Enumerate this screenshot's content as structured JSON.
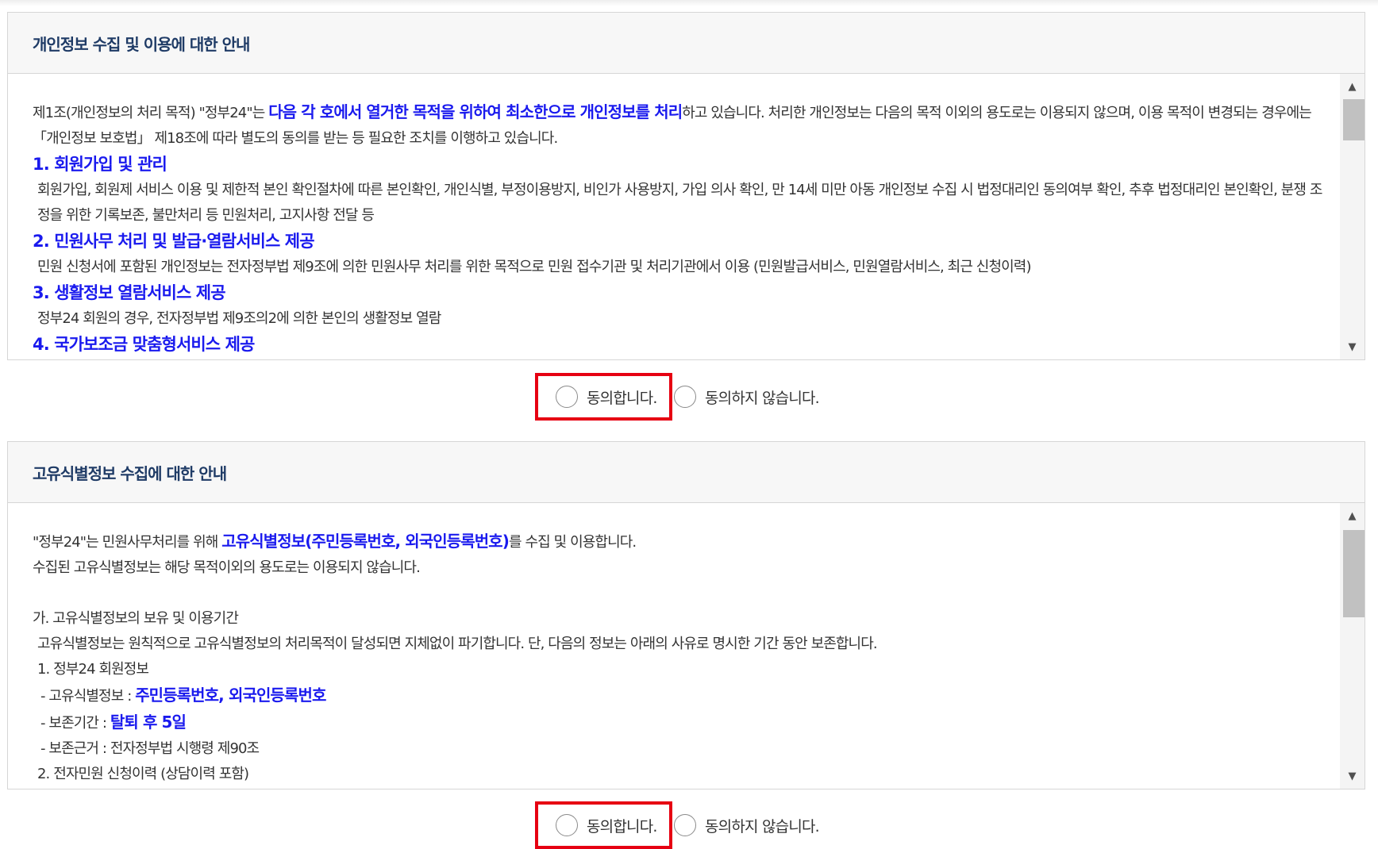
{
  "sections": [
    {
      "title": "개인정보 수집 및 이용에 대한 안내",
      "intro": {
        "pre": "제1조(개인정보의 처리 목적) \"정부24\"는 ",
        "highlight": "다음 각 호에서 열거한 목적을 위하여 최소한으로 개인정보를 처리",
        "post": "하고 있습니다. 처리한 개인정보는 다음의 목적 이외의 용도로는 이용되지 않으며, 이용 목적이 변경되는 경우에는 「개인정보 보호법」 제18조에 따라 별도의 동의를 받는 등 필요한 조치를 이행하고 있습니다."
      },
      "items": [
        {
          "heading": "1. 회원가입 및 관리",
          "text": "회원가입, 회원제 서비스 이용 및 제한적 본인 확인절차에 따른 본인확인, 개인식별, 부정이용방지, 비인가 사용방지, 가입 의사 확인, 만 14세 미만 아동 개인정보 수집 시 법정대리인 동의여부 확인, 추후 법정대리인 본인확인, 분쟁 조정을 위한 기록보존, 불만처리 등 민원처리, 고지사항 전달 등"
        },
        {
          "heading": "2. 민원사무 처리 및 발급·열람서비스 제공",
          "text": "민원 신청서에 포함된 개인정보는 전자정부법 제9조에 의한 민원사무 처리를 위한 목적으로 민원 접수기관 및 처리기관에서 이용 (민원발급서비스, 민원열람서비스, 최근 신청이력)"
        },
        {
          "heading": "3. 생활정보 열람서비스 제공",
          "text": "정부24 회원의 경우, 전자정부법 제9조의2에 의한 본인의 생활정보 열람"
        },
        {
          "heading": "4. 국가보조금 맞춤형서비스 제공",
          "text": ""
        }
      ],
      "agree_label": "동의합니다.",
      "disagree_label": "동의하지 않습니다."
    },
    {
      "title": "고유식별정보 수집에 대한 안내",
      "line1": {
        "pre": "\"정부24\"는 민원사무처리를 위해 ",
        "highlight": "고유식별정보(주민등록번호, 외국인등록번호)",
        "post": "를 수집 및 이용합니다."
      },
      "line2": "수집된 고유식별정보는 해당 목적이외의 용도로는 이용되지 않습니다.",
      "subheading": "가. 고유식별정보의 보유 및 이용기간",
      "subtext": "고유식별정보는 원칙적으로 고유식별정보의 처리목적이 달성되면 지체없이 파기합니다. 단, 다음의 정보는 아래의 사유로 명시한 기간 동안 보존합니다.",
      "item1": "1. 정부24 회원정보",
      "id_info_label": "- 고유식별정보 : ",
      "id_info_value": "주민등록번호, 외국인등록번호",
      "retention_label": "- 보존기간 : ",
      "retention_value": "탈퇴 후 5일",
      "basis": "- 보존근거 : 전자정부법 시행령 제90조",
      "item2": "2. 전자민원 신청이력 (상담이력 포함)",
      "agree_label": "동의합니다.",
      "disagree_label": "동의하지 않습니다."
    }
  ],
  "icons": {
    "scroll_up": "▲",
    "scroll_down": "▼"
  },
  "colors": {
    "highlight": "#1a1aee",
    "title": "#1f3b66",
    "agree_outline": "#e60012"
  }
}
